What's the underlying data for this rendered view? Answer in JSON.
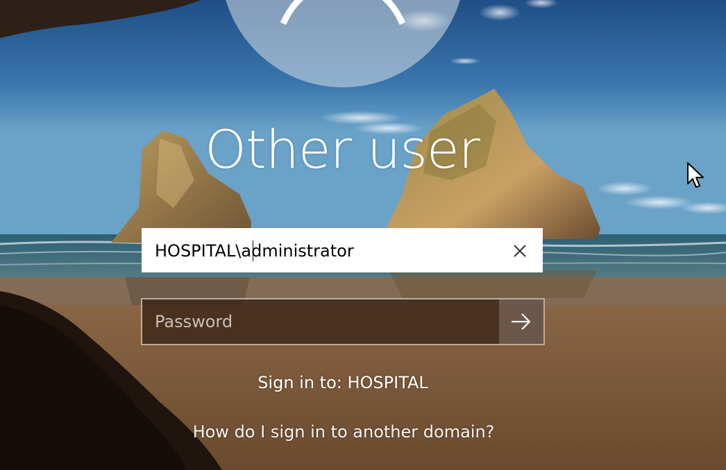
{
  "title": "Other user",
  "username": {
    "value": "HOSPITAL\\administrator"
  },
  "password": {
    "placeholder": "Password"
  },
  "sign_in_to": "Sign in to: HOSPITAL",
  "other_domain_link": "How do I sign in to another domain?",
  "icons": {
    "avatar": "user-avatar-icon",
    "clear": "close-icon",
    "submit": "arrow-right-icon",
    "pointer": "mouse-pointer-icon"
  },
  "colors": {
    "text": "#ffffff",
    "input_background": "#ffffff",
    "password_background": "#3a2418"
  }
}
